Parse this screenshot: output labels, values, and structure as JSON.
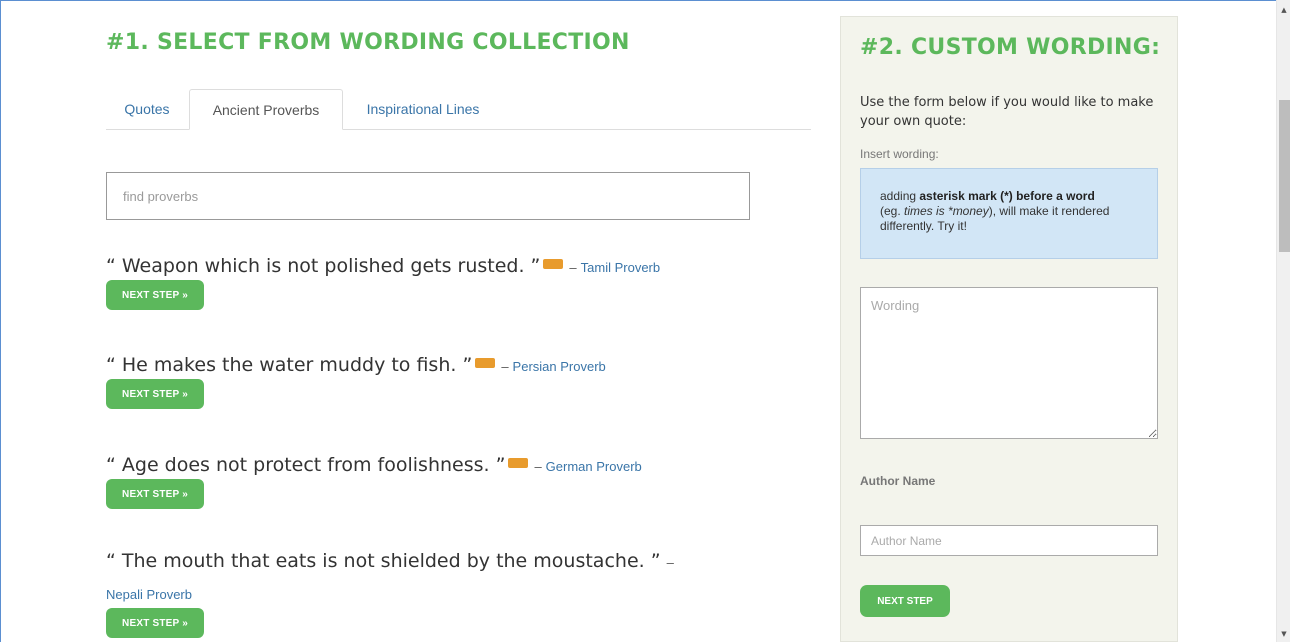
{
  "collection": {
    "heading": "#1. SELECT FROM WORDING COLLECTION",
    "tabs": [
      {
        "label": "Quotes",
        "active": false
      },
      {
        "label": "Ancient Proverbs",
        "active": true
      },
      {
        "label": "Inspirational Lines",
        "active": false
      }
    ],
    "search_placeholder": "find proverbs",
    "proverbs": [
      {
        "text": "“ Weapon which is not polished gets rusted. ”",
        "is_new": true,
        "dash": "–",
        "author": "Tamil Proverb",
        "button": "NEXT STEP »"
      },
      {
        "text": "“ He makes the water muddy to fish. ”",
        "is_new": true,
        "dash": "–",
        "author": "Persian Proverb",
        "button": "NEXT STEP »"
      },
      {
        "text": "“ Age does not protect from foolishness. ”",
        "is_new": true,
        "dash": "–",
        "author": "German Proverb",
        "button": "NEXT STEP »"
      },
      {
        "text": "“ The mouth that eats is not shielded by the moustache. ”",
        "is_new": false,
        "dash": "–",
        "author": "Nepali Proverb",
        "button": "NEXT STEP »"
      }
    ]
  },
  "custom": {
    "heading": "#2. CUSTOM WORDING:",
    "intro": "Use the form below if you would like to make your own quote:",
    "insert_label": "Insert wording:",
    "info": {
      "prefix": "adding ",
      "bold": "asterisk mark (*) before a word",
      "line2_prefix": "(eg. ",
      "example_italic": "times is *money",
      "line2_suffix": "), will make it rendered differently. Try it!"
    },
    "wording_placeholder": "Wording",
    "author_label": "Author Name",
    "author_placeholder": "Author Name",
    "button": "NEXT STEP"
  },
  "colors": {
    "accent_green": "#5cb85c",
    "link_blue": "#3a75a8",
    "new_badge": "#e89b2d",
    "info_bg": "#d2e6f6",
    "panel_bg": "#f3f4ec"
  },
  "scrollbar": {
    "up_icon": "▲",
    "down_icon": "▼"
  }
}
